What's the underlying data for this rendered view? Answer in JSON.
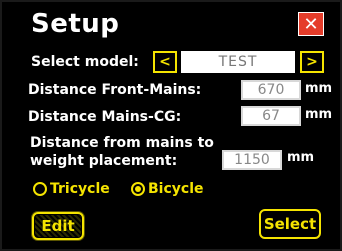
{
  "header": {
    "title": "Setup",
    "close_label": "✕"
  },
  "model": {
    "label": "Select model:",
    "prev": "<",
    "value": "TEST",
    "next": ">"
  },
  "fields": [
    {
      "label": "Distance Front-Mains:",
      "value": "670",
      "unit": "mm"
    },
    {
      "label": "Distance Mains-CG:",
      "value": "67",
      "unit": "mm"
    },
    {
      "label_line1": "Distance from mains to",
      "label_line2": "weight placement:",
      "value": "1150",
      "unit": "mm"
    }
  ],
  "gear": {
    "options": [
      {
        "label": "Tricycle",
        "selected": false
      },
      {
        "label": "Bicycle",
        "selected": true
      }
    ]
  },
  "buttons": {
    "edit": "Edit",
    "select": "Select"
  },
  "colors": {
    "accent": "#f5e400",
    "close": "#e53c2a",
    "background": "#000000"
  }
}
